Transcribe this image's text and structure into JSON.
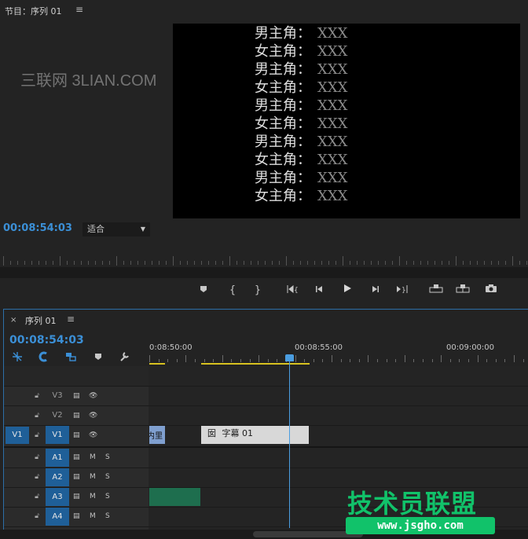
{
  "monitor": {
    "title": "节目：序列 01",
    "menu_icon": "≡",
    "timecode": "00:08:54:03",
    "fit_select": "适合",
    "watermark": "三联网 3LIAN.COM",
    "credits": [
      {
        "role": "男主角：",
        "name": "XXX"
      },
      {
        "role": "女主角：",
        "name": "XXX"
      },
      {
        "role": "男主角：",
        "name": "XXX"
      },
      {
        "role": "女主角：",
        "name": "XXX"
      },
      {
        "role": "男主角：",
        "name": "XXX"
      },
      {
        "role": "女主角：",
        "name": "XXX"
      },
      {
        "role": "男主角：",
        "name": "XXX"
      },
      {
        "role": "女主角：",
        "name": "XXX"
      },
      {
        "role": "男主角：",
        "name": "XXX"
      },
      {
        "role": "女主角：",
        "name": "XXX"
      }
    ],
    "transport_icons": [
      "marker-icon",
      "mark-in-icon",
      "mark-out-icon",
      "go-to-in-icon",
      "step-back-icon",
      "play-icon",
      "step-forward-icon",
      "go-to-out-icon",
      "lift-icon",
      "extract-icon",
      "camera-icon"
    ]
  },
  "timeline": {
    "close": "×",
    "title": "序列 01",
    "menu_icon": "≡",
    "timecode": "00:08:54:03",
    "ruler": [
      "0:08:50:00",
      "00:08:55:00",
      "00:09:00:00"
    ],
    "source_patch": "V1",
    "video_tracks": [
      "V3",
      "V2",
      "V1"
    ],
    "audio_tracks": [
      "A1",
      "A2",
      "A3",
      "A4"
    ],
    "mute_label": "M",
    "solo_label": "S",
    "clips": {
      "title_clip": "字幕 01",
      "title_icon": "囡",
      "blue_clip": "内里"
    },
    "work_area_colour": "#d8c220",
    "accent_colour": "#3b8fd6"
  },
  "brand": {
    "text": "技术员联盟",
    "url": "www.jsgho.com"
  }
}
